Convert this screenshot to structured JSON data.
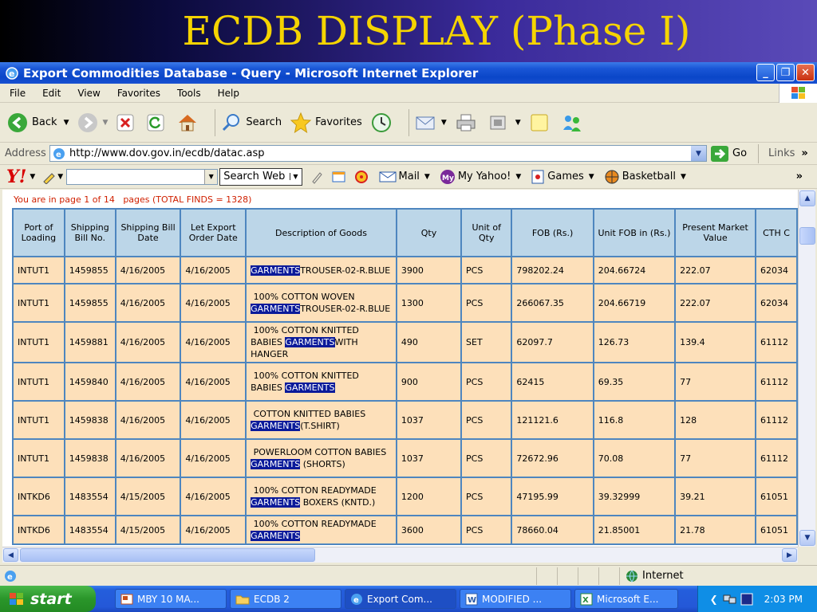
{
  "slide_title": "ECDB DISPLAY (Phase I)",
  "window": {
    "title": "Export Commodities Database - Query - Microsoft Internet Explorer"
  },
  "menu": [
    "File",
    "Edit",
    "View",
    "Favorites",
    "Tools",
    "Help"
  ],
  "toolbar": {
    "back": "Back",
    "search": "Search",
    "favorites": "Favorites"
  },
  "address": {
    "label": "Address",
    "url": "http://www.dov.gov.in/ecdb/datac.asp",
    "go": "Go",
    "links": "Links"
  },
  "yahoo": {
    "logo": "Y!",
    "search_btn": "Search Web",
    "mail": "Mail",
    "my_yahoo": "My Yahoo!",
    "games": "Games",
    "basketball": "Basketball"
  },
  "page_info": "You are in page 1 of 14   pages (TOTAL FINDS = 1328)",
  "table": {
    "headers": [
      "Port of Loading",
      "Shipping Bill No.",
      "Shipping Bill Date",
      "Let Export Order Date",
      "Description of Goods",
      "Qty",
      "Unit of Qty",
      "FOB (Rs.)",
      "Unit FOB in (Rs.)",
      "Present Market Value",
      "CTH C"
    ],
    "rows": [
      {
        "port": "INTUT1",
        "bill_no": "1459855",
        "bill_date": "4/16/2005",
        "leo_date": "4/16/2005",
        "desc_pre": "",
        "desc_hl": "GARMENTS",
        "desc_post": "TROUSER-02-R.BLUE",
        "qty": "3900",
        "unit": "PCS",
        "fob": "798202.24",
        "unit_fob": "204.66724",
        "pmv": "222.07",
        "cth": "62034"
      },
      {
        "port": "INTUT1",
        "bill_no": "1459855",
        "bill_date": "4/16/2005",
        "leo_date": "4/16/2005",
        "desc_pre": " 100% COTTON WOVEN ",
        "desc_hl": "GARMENTS",
        "desc_post": "TROUSER-02-R.BLUE",
        "qty": "1300",
        "unit": "PCS",
        "fob": "266067.35",
        "unit_fob": "204.66719",
        "pmv": "222.07",
        "cth": "62034"
      },
      {
        "port": "INTUT1",
        "bill_no": "1459881",
        "bill_date": "4/16/2005",
        "leo_date": "4/16/2005",
        "desc_pre": " 100% COTTON KNITTED BABIES ",
        "desc_hl": "GARMENTS",
        "desc_post": "WITH HANGER",
        "qty": "490",
        "unit": "SET",
        "fob": "62097.7",
        "unit_fob": "126.73",
        "pmv": "139.4",
        "cth": "61112"
      },
      {
        "port": "INTUT1",
        "bill_no": "1459840",
        "bill_date": "4/16/2005",
        "leo_date": "4/16/2005",
        "desc_pre": " 100% COTTON KNITTED BABIES ",
        "desc_hl": "GARMENTS",
        "desc_post": "",
        "qty": "900",
        "unit": "PCS",
        "fob": "62415",
        "unit_fob": "69.35",
        "pmv": "77",
        "cth": "61112"
      },
      {
        "port": "INTUT1",
        "bill_no": "1459838",
        "bill_date": "4/16/2005",
        "leo_date": "4/16/2005",
        "desc_pre": " COTTON KNITTED BABIES ",
        "desc_hl": "GARMENTS",
        "desc_post": "(T.SHIRT)",
        "qty": "1037",
        "unit": "PCS",
        "fob": "121121.6",
        "unit_fob": "116.8",
        "pmv": "128",
        "cth": "61112"
      },
      {
        "port": "INTUT1",
        "bill_no": "1459838",
        "bill_date": "4/16/2005",
        "leo_date": "4/16/2005",
        "desc_pre": " POWERLOOM COTTON BABIES ",
        "desc_hl": "GARMENTS",
        "desc_post": " (SHORTS)",
        "qty": "1037",
        "unit": "PCS",
        "fob": "72672.96",
        "unit_fob": "70.08",
        "pmv": "77",
        "cth": "61112"
      },
      {
        "port": "INTKD6",
        "bill_no": "1483554",
        "bill_date": "4/15/2005",
        "leo_date": "4/16/2005",
        "desc_pre": " 100% COTTON READYMADE ",
        "desc_hl": "GARMENTS",
        "desc_post": " BOXERS (KNTD.)",
        "qty": "1200",
        "unit": "PCS",
        "fob": "47195.99",
        "unit_fob": "39.32999",
        "pmv": "39.21",
        "cth": "61051"
      },
      {
        "port": "INTKD6",
        "bill_no": "1483554",
        "bill_date": "4/15/2005",
        "leo_date": "4/16/2005",
        "desc_pre": " 100% COTTON READYMADE ",
        "desc_hl": "GARMENTS",
        "desc_post": "",
        "qty": "3600",
        "unit": "PCS",
        "fob": "78660.04",
        "unit_fob": "21.85001",
        "pmv": "21.78",
        "cth": "61051"
      }
    ]
  },
  "status": {
    "zone": "Internet"
  },
  "taskbar": {
    "start": "start",
    "tasks": [
      "MBY 10 MA...",
      "ECDB 2",
      "Export Com...",
      "MODIFIED ...",
      "Microsoft E..."
    ],
    "clock": "2:03 PM"
  },
  "colors": {
    "title_yellow": "#f5d400",
    "table_border": "#4e86bf",
    "header_bg": "#bcd6e8",
    "cell_bg": "#fde0ba",
    "highlight": "#0a1a9a",
    "page_info_red": "#d02000"
  }
}
